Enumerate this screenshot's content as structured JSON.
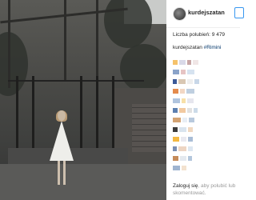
{
  "post": {
    "username": "kurdejszatan",
    "likes_text": "Liczba polubień: 9 479",
    "caption_user": "kurdejszatan",
    "caption_tag": "#Rimini"
  },
  "footer": {
    "login_link": "Zaloguj się",
    "login_rest": ", aby polubić lub skomentować."
  },
  "colors": {
    "link_blue": "#3897f0",
    "text_dark": "#262626",
    "text_muted": "#999999"
  },
  "icons": [
    "avatar",
    "follow-button"
  ]
}
